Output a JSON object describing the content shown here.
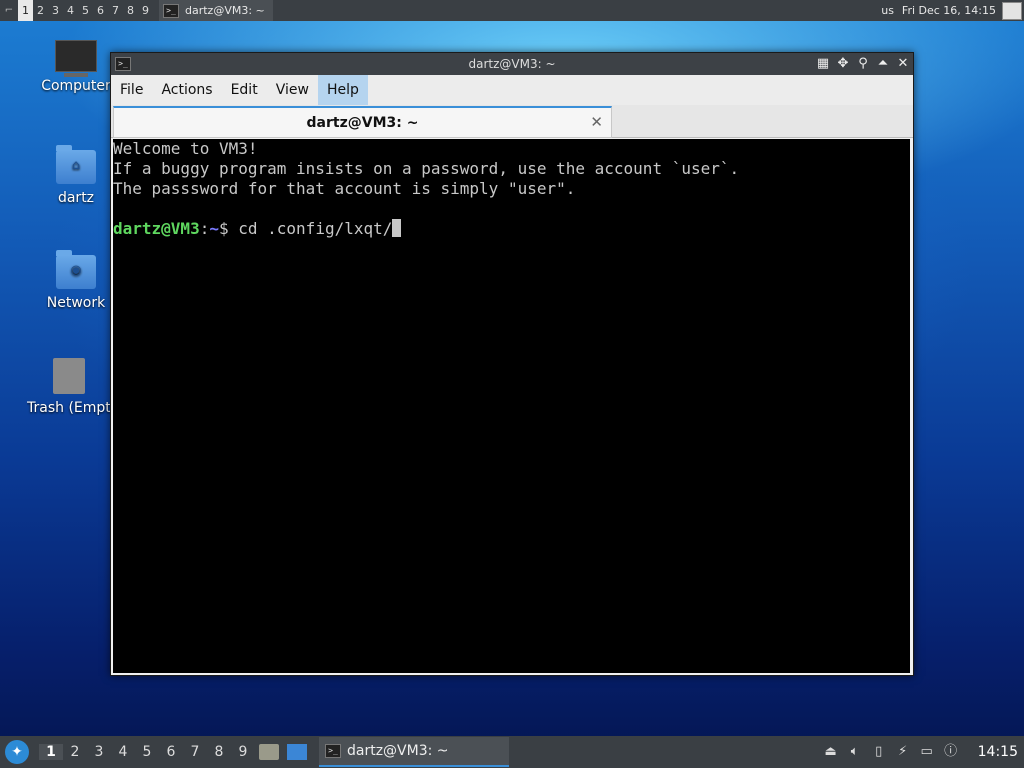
{
  "top_panel": {
    "workspaces": [
      "1",
      "2",
      "3",
      "4",
      "5",
      "6",
      "7",
      "8",
      "9"
    ],
    "active_workspace_index": 0,
    "task_title": "dartz@VM3: ~",
    "keyboard_layout": "us",
    "datetime": "Fri Dec 16, 14:15"
  },
  "desktop": {
    "icons": [
      {
        "label": "Computer",
        "icon": "computer-icon"
      },
      {
        "label": "dartz",
        "icon": "home-folder-icon"
      },
      {
        "label": "Network",
        "icon": "network-folder-icon"
      },
      {
        "label": "Trash (Empty)",
        "icon": "trash-icon"
      }
    ]
  },
  "window": {
    "title": "dartz@VM3: ~",
    "menu": [
      "File",
      "Actions",
      "Edit",
      "View",
      "Help"
    ],
    "active_menu": "Help",
    "tab_title": "dartz@VM3: ~",
    "terminal": {
      "lines": [
        "Welcome to VM3!",
        "If a buggy program insists on a password, use the account `user`.",
        "The passsword for that account is simply \"user\".",
        ""
      ],
      "prompt_user_host": "dartz@VM3",
      "prompt_sep": ":",
      "prompt_path": "~",
      "prompt_symbol": "$ ",
      "command": "cd .config/lxqt/"
    }
  },
  "bottom_panel": {
    "start_icon": "lxqt-start-icon",
    "workspaces": [
      "1",
      "2",
      "3",
      "4",
      "5",
      "6",
      "7",
      "8",
      "9"
    ],
    "active_workspace_index": 0,
    "task_title": "dartz@VM3: ~",
    "clock": "14:15",
    "colors": {
      "accent": "#3a8fd8",
      "panel": "#3a3f44"
    }
  }
}
